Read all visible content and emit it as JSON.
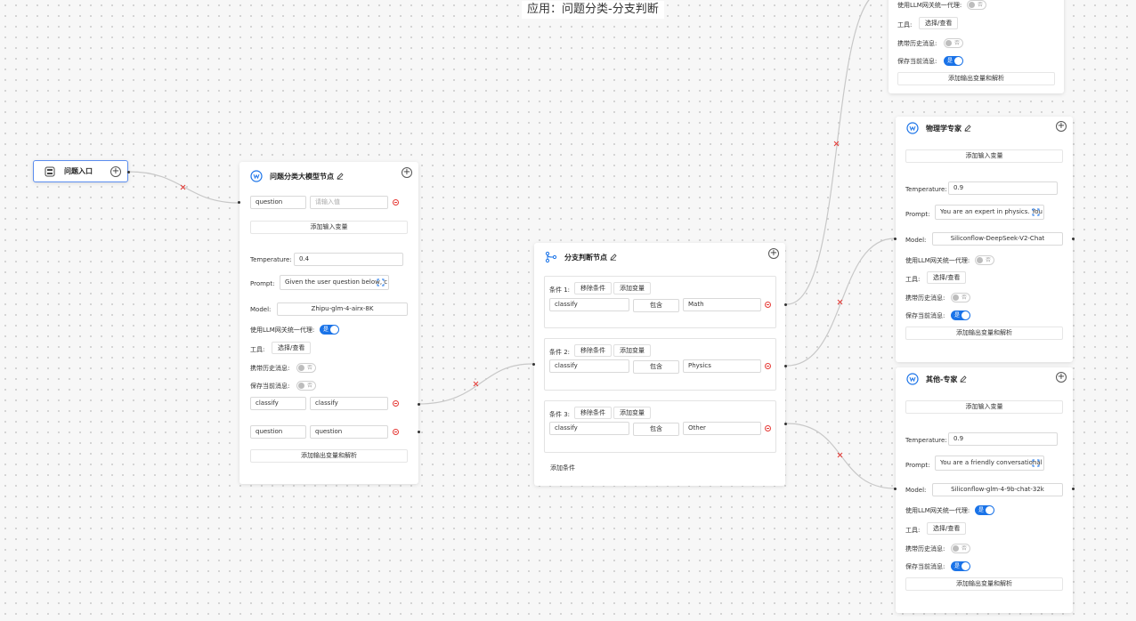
{
  "app": {
    "title": "应用：问题分类-分支判断"
  },
  "nodes": {
    "entry": {
      "title": "问题入口"
    },
    "classifier": {
      "title": "问题分类大模型节点",
      "inputs": [
        {
          "name": "question",
          "placeholder": "请输入值"
        }
      ],
      "add_input_label": "添加输入变量",
      "temperature_label": "Temperature:",
      "temperature": "0.4",
      "prompt_label": "Prompt:",
      "prompt": "Given the user question below, c",
      "model_label": "Model:",
      "model": "Zhipu-glm-4-airx-8K",
      "proxy_label": "使用LLM网关统一代理:",
      "proxy_state": "是",
      "tools_label": "工具:",
      "tools_button": "选择/查看",
      "history_label": "携带历史消息:",
      "history_state": "否",
      "save_label": "保存当前消息:",
      "save_state": "否",
      "outputs": [
        {
          "name": "classify",
          "value": "classify"
        },
        {
          "name": "question",
          "value": "question"
        }
      ],
      "add_output_label": "添加输出变量和解析"
    },
    "branch": {
      "title": "分支判断节点",
      "remove_label": "移除条件",
      "add_var_label": "添加变量",
      "conditions": [
        {
          "label": "条件 1:",
          "var": "classify",
          "op": "包含",
          "value": "Math"
        },
        {
          "label": "条件 2:",
          "var": "classify",
          "op": "包含",
          "value": "Physics"
        },
        {
          "label": "条件 3:",
          "var": "classify",
          "op": "包含",
          "value": "Other"
        }
      ],
      "add_condition_label": "添加条件"
    },
    "math": {
      "proxy_label": "使用LLM网关统一代理:",
      "proxy_state": "否",
      "tools_label": "工具:",
      "tools_button": "选择/查看",
      "history_label": "携带历史消息:",
      "history_state": "否",
      "save_label": "保存当前消息:",
      "save_state": "是",
      "add_output_label": "添加输出变量和解析"
    },
    "physics": {
      "title": "物理学专家",
      "add_input_label": "添加输入变量",
      "temperature_label": "Temperature:",
      "temperature": "0.9",
      "prompt_label": "Prompt:",
      "prompt": "You are an expert in physics. You",
      "model_label": "Model:",
      "model": "Siliconflow-DeepSeek-V2-Chat",
      "proxy_label": "使用LLM网关统一代理:",
      "proxy_state": "否",
      "tools_label": "工具:",
      "tools_button": "选择/查看",
      "history_label": "携带历史消息:",
      "history_state": "否",
      "save_label": "保存当前消息:",
      "save_state": "是",
      "add_output_label": "添加输出变量和解析"
    },
    "other": {
      "title": "其他-专家",
      "add_input_label": "添加输入变量",
      "temperature_label": "Temperature:",
      "temperature": "0.9",
      "prompt_label": "Prompt:",
      "prompt": "You are a friendly conversational",
      "model_label": "Model:",
      "model": "Siliconflow-glm-4-9b-chat-32k",
      "proxy_label": "使用LLM网关统一代理:",
      "proxy_state": "是",
      "tools_label": "工具:",
      "tools_button": "选择/查看",
      "history_label": "携带历史消息:",
      "history_state": "否",
      "save_label": "保存当前消息:",
      "save_state": "是",
      "add_output_label": "添加输出变量和解析"
    }
  },
  "colors": {
    "accent": "#1a73e8",
    "danger": "#e53935",
    "edge": "#c8c8c8"
  }
}
